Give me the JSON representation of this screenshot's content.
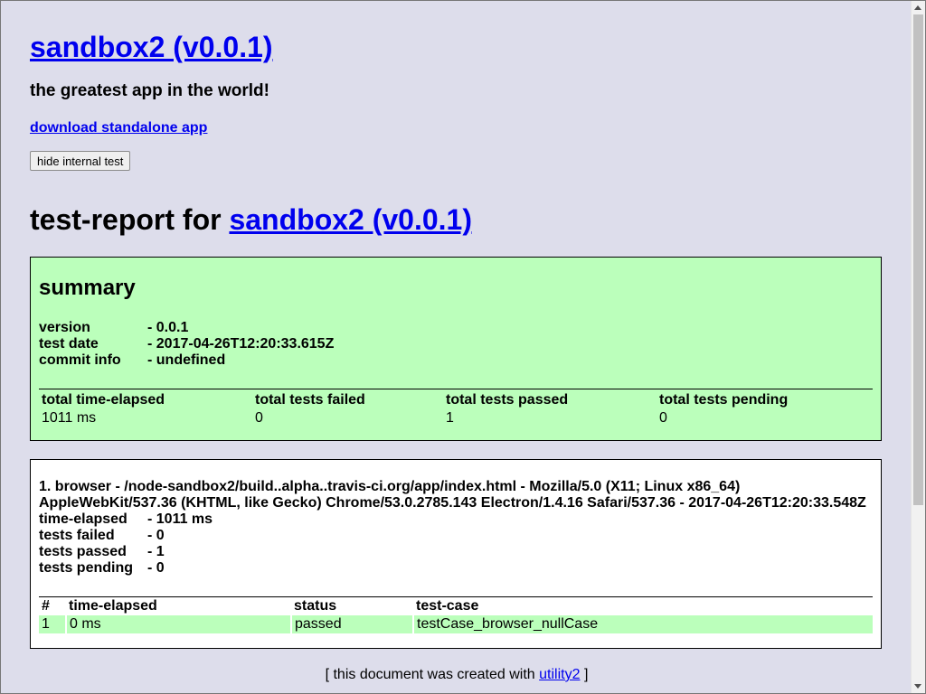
{
  "header": {
    "app_title": "sandbox2 (v0.0.1)",
    "tagline": "the greatest app in the world!",
    "download_link": "download standalone app",
    "hide_button": "hide internal test"
  },
  "report": {
    "title_prefix": "test-report for",
    "title_link": "sandbox2 (v0.0.1)"
  },
  "summary": {
    "heading": "summary",
    "version_label": "version",
    "version_value": "- 0.0.1",
    "date_label": "test date",
    "date_value": "- 2017-04-26T12:20:33.615Z",
    "commit_label": "commit info",
    "commit_value": "- undefined",
    "columns": [
      "total time-elapsed",
      "total tests failed",
      "total tests passed",
      "total tests pending"
    ],
    "values": [
      "1011 ms",
      "0",
      "1",
      "0"
    ]
  },
  "browser": {
    "heading_line1": "1. browser - /node-sandbox2/build..alpha..travis-ci.org/app/index.html - Mozilla/5.0 (X11; Linux x86_64)",
    "heading_line2": "AppleWebKit/537.36 (KHTML, like Gecko) Chrome/53.0.2785.143 Electron/1.4.16 Safari/537.36 - 2017-04-26T12:20:33.548Z",
    "elapsed_label": "time-elapsed",
    "elapsed_value": "- 1011 ms",
    "failed_label": "tests failed",
    "failed_value": "- 0",
    "passed_label": "tests passed",
    "passed_value": "- 1",
    "pending_label": "tests pending",
    "pending_value": "- 0",
    "columns": [
      "#",
      "time-elapsed",
      "status",
      "test-case"
    ],
    "rows": [
      [
        "1",
        "0 ms",
        "passed",
        "testCase_browser_nullCase"
      ]
    ]
  },
  "footer": {
    "prefix": "[ this document was created with",
    "link": "utility2",
    "suffix": "]"
  },
  "colors": {
    "background": "#ddddeb",
    "pass_green": "#bbffbb",
    "link": "#0000ee"
  }
}
